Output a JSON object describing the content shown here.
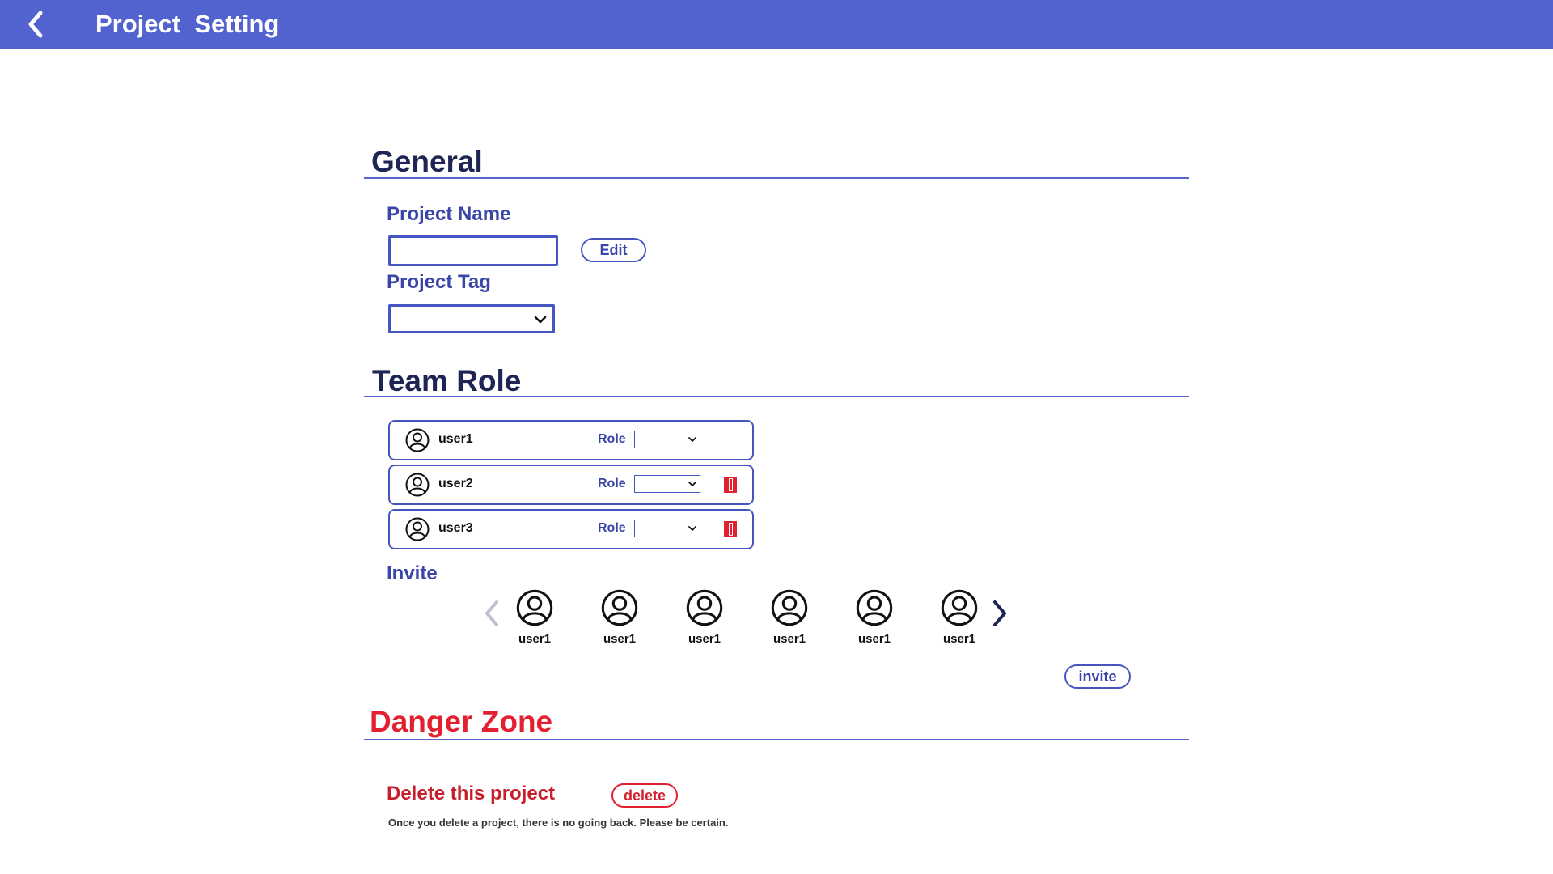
{
  "header": {
    "title": "Project  Setting",
    "back_icon": "chevron-left-icon",
    "bg_color": "#5262CE"
  },
  "general": {
    "heading": "General",
    "project_name_label": "Project Name",
    "project_name_value": "",
    "edit_button": "Edit",
    "project_tag_label": "Project Tag",
    "project_tag_value": ""
  },
  "team": {
    "heading": "Team Role",
    "members": [
      {
        "name": "user1",
        "role_label": "Role",
        "role_value": "",
        "removable": false
      },
      {
        "name": "user2",
        "role_label": "Role",
        "role_value": "",
        "removable": true
      },
      {
        "name": "user3",
        "role_label": "Role",
        "role_value": "",
        "removable": true
      }
    ],
    "invite_label": "Invite",
    "invitees": [
      "user1",
      "user1",
      "user1",
      "user1",
      "user1",
      "user1"
    ],
    "invite_button": "invite"
  },
  "danger": {
    "heading": "Danger Zone",
    "delete_label": "Delete this project",
    "delete_button": "delete",
    "note": "Once you delete a project, there is no going back. Please be certain."
  },
  "colors": {
    "accent": "#4555C0",
    "danger": "#E3202F",
    "heading": "#1E2453"
  }
}
